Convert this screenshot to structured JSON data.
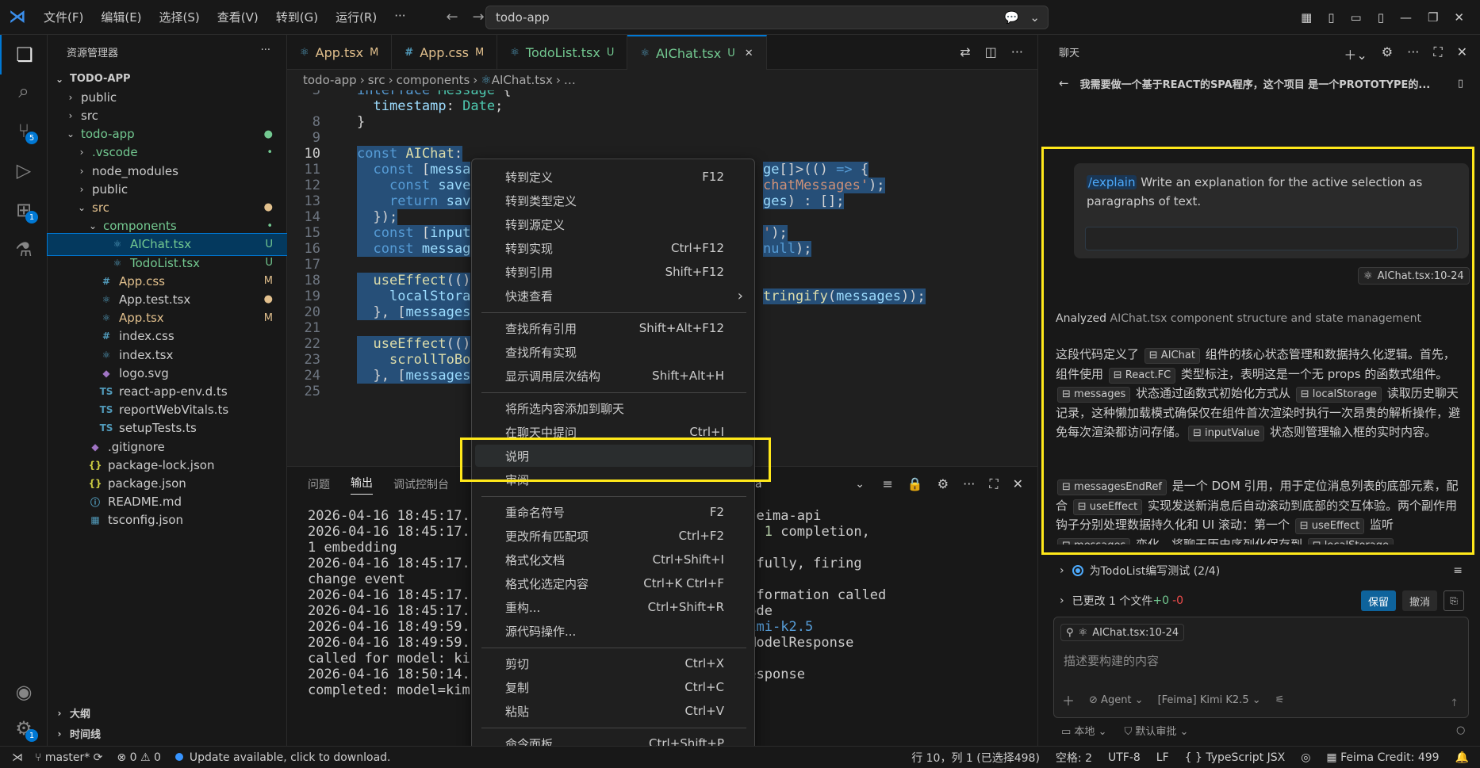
{
  "titlebar": {
    "menus": [
      "文件(F)",
      "编辑(E)",
      "选择(S)",
      "查看(V)",
      "转到(G)",
      "运行(R)",
      "···"
    ],
    "search": "todo-app"
  },
  "activity": {
    "scm_badge": "5",
    "ext_badge": "1",
    "settings_badge": "1"
  },
  "explorer": {
    "title": "资源管理器",
    "more": "···",
    "rows": [
      {
        "label": "TODO-APP",
        "chev": "⌄",
        "icon": "",
        "status": "",
        "depth": 0
      },
      {
        "label": "public",
        "chev": "›",
        "icon": "",
        "status": "",
        "depth": 1
      },
      {
        "label": "src",
        "chev": "›",
        "icon": "",
        "status": "",
        "depth": 1
      },
      {
        "label": "todo-app",
        "chev": "⌄",
        "icon": "",
        "status": "●",
        "depth": 1
      },
      {
        "label": ".vscode",
        "chev": "›",
        "icon": "",
        "status": "•",
        "depth": 2
      },
      {
        "label": "node_modules",
        "chev": "›",
        "icon": "",
        "status": "",
        "depth": 2
      },
      {
        "label": "public",
        "chev": "›",
        "icon": "",
        "status": "",
        "depth": 2
      },
      {
        "label": "src",
        "chev": "⌄",
        "icon": "",
        "status": "●",
        "depth": 2
      },
      {
        "label": "components",
        "chev": "⌄",
        "icon": "",
        "status": "•",
        "depth": 3
      },
      {
        "label": "AIChat.tsx",
        "chev": "",
        "icon": "⚛",
        "status": "U",
        "depth": 4
      },
      {
        "label": "TodoList.tsx",
        "chev": "",
        "icon": "⚛",
        "status": "U",
        "depth": 4
      },
      {
        "label": "App.css",
        "chev": "",
        "icon": "#",
        "status": "M",
        "depth": 3
      },
      {
        "label": "App.test.tsx",
        "chev": "",
        "icon": "⚛",
        "status": "●",
        "depth": 3
      },
      {
        "label": "App.tsx",
        "chev": "",
        "icon": "⚛",
        "status": "M",
        "depth": 3
      },
      {
        "label": "index.css",
        "chev": "",
        "icon": "#",
        "status": "",
        "depth": 3
      },
      {
        "label": "index.tsx",
        "chev": "",
        "icon": "⚛",
        "status": "",
        "depth": 3
      },
      {
        "label": "logo.svg",
        "chev": "",
        "icon": "◆",
        "status": "",
        "depth": 3
      },
      {
        "label": "react-app-env.d.ts",
        "chev": "",
        "icon": "TS",
        "status": "",
        "depth": 3
      },
      {
        "label": "reportWebVitals.ts",
        "chev": "",
        "icon": "TS",
        "status": "",
        "depth": 3
      },
      {
        "label": "setupTests.ts",
        "chev": "",
        "icon": "TS",
        "status": "",
        "depth": 3
      },
      {
        "label": ".gitignore",
        "chev": "",
        "icon": "◆",
        "status": "",
        "depth": 2
      },
      {
        "label": "package-lock.json",
        "chev": "",
        "icon": "{}",
        "status": "",
        "depth": 2
      },
      {
        "label": "package.json",
        "chev": "",
        "icon": "{}",
        "status": "",
        "depth": 2
      },
      {
        "label": "README.md",
        "chev": "",
        "icon": "ⓘ",
        "status": "",
        "depth": 2
      },
      {
        "label": "tsconfig.json",
        "chev": "",
        "icon": "▦",
        "status": "",
        "depth": 2
      }
    ],
    "outline": "大纲",
    "timeline": "时间线"
  },
  "tabs": [
    {
      "icon": "⚛",
      "label": "App.tsx",
      "status": "M"
    },
    {
      "icon": "#",
      "label": "App.css",
      "status": "M"
    },
    {
      "icon": "⚛",
      "label": "TodoList.tsx",
      "status": "U"
    },
    {
      "icon": "⚛",
      "label": "AIChat.tsx",
      "status": "U"
    }
  ],
  "breadcrumb": [
    "todo-app",
    "src",
    "components",
    "AIChat.tsx",
    "…"
  ],
  "code": [
    {
      "ln": "3",
      "html": "<span class='kw'>interface</span> <span class='ty'>Message</span> <span class='pn'>{</span>"
    },
    {
      "ln": "",
      "html": "  <span class='id'>timestamp</span><span class='pn'>:</span> <span class='ty'>Date</span><span class='pn'>;</span>"
    },
    {
      "ln": "8",
      "html": "<span class='pn'>}</span>"
    },
    {
      "ln": "9",
      "html": ""
    },
    {
      "ln": "10",
      "html": "<span class='kw'>const</span> <span class='fn'>AIChat</span><span class='pn'>:</span>"
    },
    {
      "ln": "11",
      "html": "  <span class='kw'>const</span> <span class='pn'>[</span><span class='id'>messa</span>"
    },
    {
      "ln": "12",
      "html": "    <span class='kw'>const</span> <span class='id'>save</span>"
    },
    {
      "ln": "13",
      "html": "    <span class='kw'>return</span> <span class='id'>sav</span>"
    },
    {
      "ln": "14",
      "html": "  <span class='pn'>});</span>"
    },
    {
      "ln": "15",
      "html": "  <span class='kw'>const</span> <span class='pn'>[</span><span class='id'>input</span>"
    },
    {
      "ln": "16",
      "html": "  <span class='kw'>const</span> <span class='id'>messag</span>"
    },
    {
      "ln": "17",
      "html": ""
    },
    {
      "ln": "18",
      "html": "  <span class='fn'>useEffect</span><span class='pn'>(()</span>"
    },
    {
      "ln": "19",
      "html": "    <span class='id'>localStora</span>"
    },
    {
      "ln": "20",
      "html": "  <span class='pn'>}, [</span><span class='id'>messages</span>"
    },
    {
      "ln": "21",
      "html": ""
    },
    {
      "ln": "22",
      "html": "  <span class='fn'>useEffect</span><span class='pn'>(()</span>"
    },
    {
      "ln": "23",
      "html": "    <span class='fn'>scrollToBo</span>"
    },
    {
      "ln": "24",
      "html": "  <span class='pn'>}, [</span><span class='id'>messages</span>"
    },
    {
      "ln": "25",
      "html": ""
    }
  ],
  "code_right": [
    {
      "row": 5,
      "html": "<span class='id'>ge</span><span class='pn'>[]&gt;(()</span> <span class='kw'>=&gt;</span> <span class='pn'>{</span>"
    },
    {
      "row": 6,
      "html": "<span class='str'>chatMessages'</span><span class='pn'>);</span>"
    },
    {
      "row": 7,
      "html": "<span class='id'>ges</span><span class='pn'>)</span> <span class='pn'>:</span> <span class='pn'>[];</span>"
    },
    {
      "row": 9,
      "html": "<span class='str'>'</span><span class='pn'>);</span>"
    },
    {
      "row": 10,
      "html": "<span class='kw'>null</span><span class='pn'>);</span>"
    },
    {
      "row": 13,
      "html": "<span class='fn'>tringify</span><span class='pn'>(</span><span class='id'>messages</span><span class='pn'>));</span>"
    }
  ],
  "panel": {
    "tabs": [
      "问题",
      "输出",
      "调试控制台"
    ],
    "select": "a",
    "lines": [
      "2026-04-16 18:45:17.",
      "2026-04-16 18:45:17.",
      "1 embedding",
      "2026-04-16 18:45:17.",
      "change event",
      "2026-04-16 18:45:17.",
      "2026-04-16 18:45:17.",
      "2026-04-16 18:49:59.",
      "2026-04-16 18:49:59.",
      "called for model: ki",
      "2026-04-16 18:50:14.",
      "completed: model=kim"
    ],
    "lines_right": [
      {
        "row": 0,
        "text": "g models from feima-api"
      },
      {
        "row": 1,
        "html": "models: <span class='num'>9</span> chat, <span class='num'>1</span> completion,"
      },
      {
        "row": 3,
        "text": "fetched successfully, firing"
      },
      {
        "row": 5,
        "text": "uageModelChatInformation called"
      },
      {
        "row": 6,
        "text": "models to VS Code"
      },
      {
        "row": 7,
        "html": "t for model: <span class='kw'>kimi-k2.5</span>"
      },
      {
        "row": 8,
        "text": "rovideLanguageModelResponse"
      },
      {
        "row": 10,
        "text": "ndpoint] LLM response"
      }
    ]
  },
  "context_menu": [
    {
      "label": "转到定义",
      "shortcut": "F12"
    },
    {
      "label": "转到类型定义",
      "shortcut": ""
    },
    {
      "label": "转到源定义",
      "shortcut": ""
    },
    {
      "label": "转到实现",
      "shortcut": "Ctrl+F12"
    },
    {
      "label": "转到引用",
      "shortcut": "Shift+F12"
    },
    {
      "label": "快速查看",
      "shortcut": "›"
    },
    {
      "sep": true
    },
    {
      "label": "查找所有引用",
      "shortcut": "Shift+Alt+F12"
    },
    {
      "label": "查找所有实现",
      "shortcut": ""
    },
    {
      "label": "显示调用层次结构",
      "shortcut": "Shift+Alt+H"
    },
    {
      "sep": true
    },
    {
      "label": "将所选内容添加到聊天",
      "shortcut": ""
    },
    {
      "label": "在聊天中提问",
      "shortcut": "Ctrl+I"
    },
    {
      "label": "说明",
      "shortcut": "",
      "highlight": true
    },
    {
      "label": "审阅",
      "shortcut": ""
    },
    {
      "sep": true
    },
    {
      "label": "重命名符号",
      "shortcut": "F2"
    },
    {
      "label": "更改所有匹配项",
      "shortcut": "Ctrl+F2"
    },
    {
      "label": "格式化文档",
      "shortcut": "Ctrl+Shift+I"
    },
    {
      "label": "格式化选定内容",
      "shortcut": "Ctrl+K Ctrl+F"
    },
    {
      "label": "重构...",
      "shortcut": "Ctrl+Shift+R"
    },
    {
      "label": "源代码操作...",
      "shortcut": ""
    },
    {
      "sep": true
    },
    {
      "label": "剪切",
      "shortcut": "Ctrl+X"
    },
    {
      "label": "复制",
      "shortcut": "Ctrl+C"
    },
    {
      "label": "粘贴",
      "shortcut": "Ctrl+V"
    },
    {
      "sep": true
    },
    {
      "label": "命令面板...",
      "shortcut": "Ctrl+Shift+P"
    }
  ],
  "chat": {
    "header": "聊天",
    "title": "我需要做一个基于REACT的SPA程序，这个项目 是一个PROTOTYPE的...",
    "user_cmd": "/explain",
    "user_text": " Write an explanation for the active selection as paragraphs of text.",
    "ref_chip": "AIChat.tsx:10-24",
    "analyzed_lead": "Analyzed",
    "analyzed_rest": " AIChat.tsx component structure and state management",
    "para1": "这段代码定义了 <span class='ic'>⊟ AIChat</span> 组件的核心状态管理和数据持久化逻辑。首先，组件使用 <span class='ic'>⊟ React.FC</span> 类型标注，表明这是一个无 props 的函数式组件。<span class='ic'>⊟ messages</span> 状态通过函数式初始化方式从 <span class='ic'>⊟ localStorage</span> 读取历史聊天记录，这种懒加载模式确保仅在组件首次渲染时执行一次昂贵的解析操作，避免每次渲染都访问存储。<span class='ic'>⊟ inputValue</span> 状态则管理输入框的实时内容。",
    "para2": "<span class='ic'>⊟ messagesEndRef</span> 是一个 DOM 引用，用于定位消息列表的底部元素，配合 <span class='ic'>⊟ useEffect</span> 实现发送新消息后自动滚动到底部的交互体验。两个副作用钩子分别处理数据持久化和 UI 滚动：第一个 <span class='ic'>⊟ useEffect</span> 监听 <span class='ic'>⊟ messages</span> 变化，将聊天历史序列化保存到 <span class='ic'>⊟ localStorage</span>",
    "todo": "为TodoList编写测试 (2/4)",
    "changes_lead": "已更改 1 个文件 ",
    "changes_add": "+0",
    "changes_del": "-0",
    "keep": "保留",
    "undo": "撤消",
    "input_ctx": "AIChat.tsx:10-24",
    "placeholder": "描述要构建的内容",
    "agent": "Agent",
    "model": "[Feima] Kimi K2.5",
    "local": "本地",
    "approval": "默认审批"
  },
  "status": {
    "branch": "master*",
    "problems": "⊗ 0 ⚠ 0",
    "update": "Update available, click to download.",
    "position": "行 10，列 1 (已选择498)",
    "spaces": "空格: 2",
    "encoding": "UTF-8",
    "eol": "LF",
    "language": "{ } TypeScript JSX",
    "credit": "Feima Credit: 499"
  }
}
